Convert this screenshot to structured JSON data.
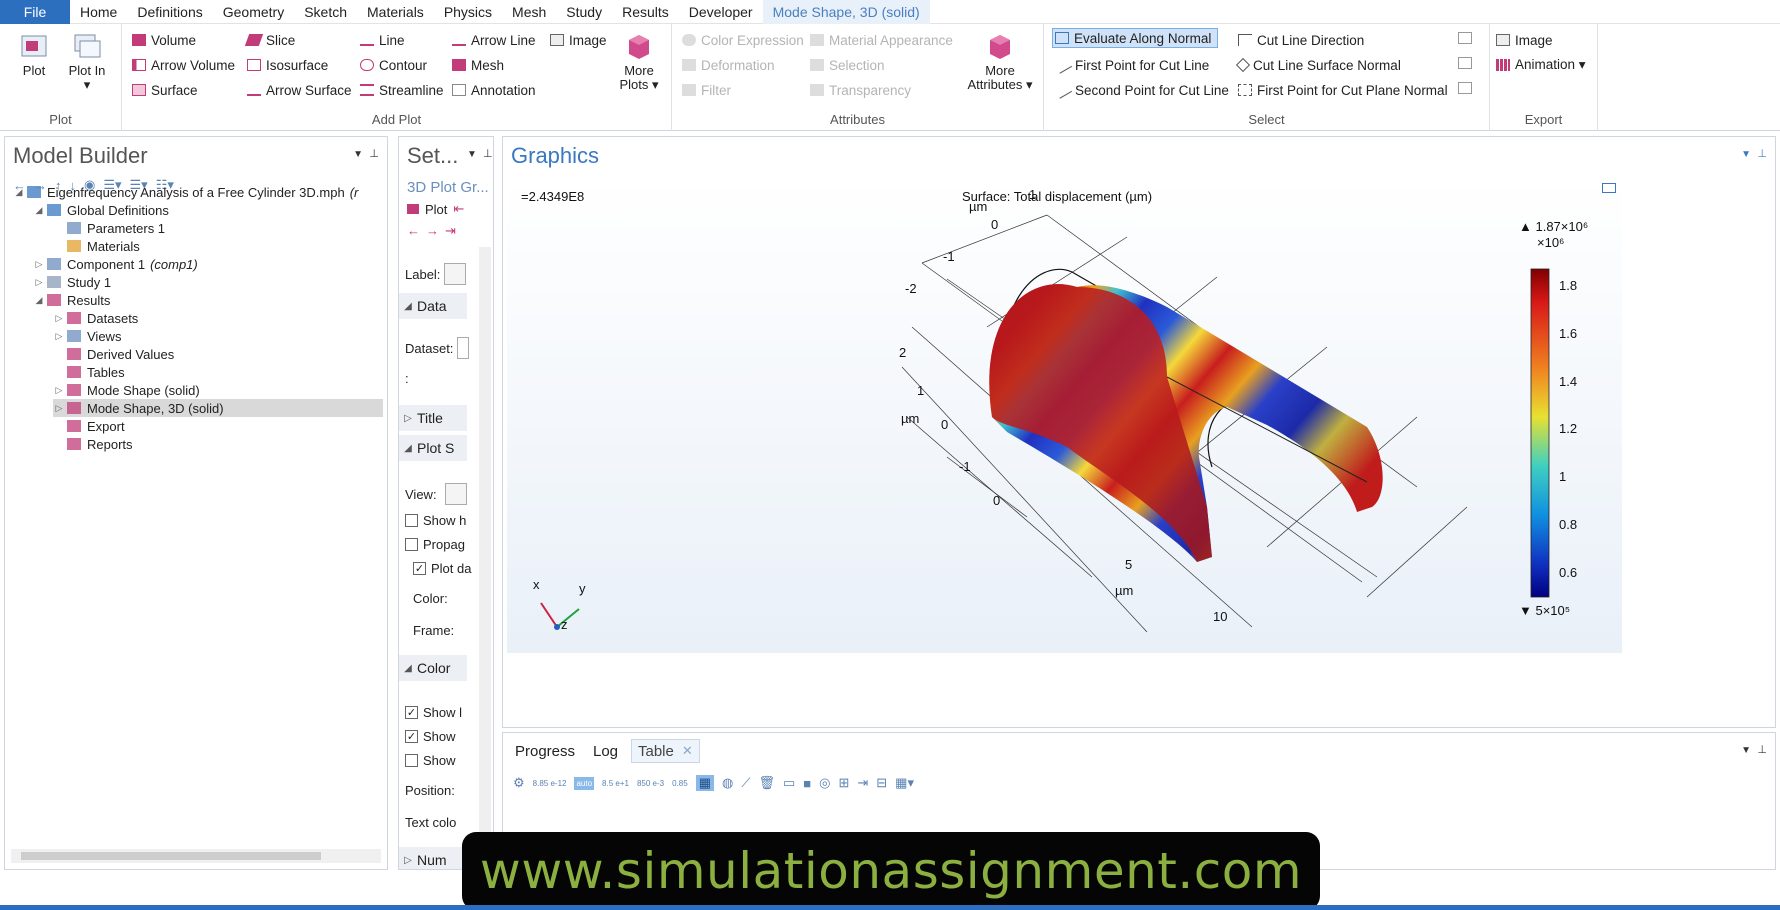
{
  "menu": {
    "file": "File",
    "items": [
      "Home",
      "Definitions",
      "Geometry",
      "Sketch",
      "Materials",
      "Physics",
      "Mesh",
      "Study",
      "Results",
      "Developer"
    ],
    "context_tab": "Mode Shape, 3D (solid)"
  },
  "ribbon": {
    "plot_group": {
      "label": "Plot",
      "plot": "Plot",
      "plot_in": "Plot In ▾"
    },
    "add_plot_group": {
      "label": "Add Plot",
      "col1": [
        "Volume",
        "Arrow Volume",
        "Surface"
      ],
      "col2": [
        "Slice",
        "Isosurface",
        "Arrow Surface"
      ],
      "col3": [
        "Line",
        "Contour",
        "Streamline"
      ],
      "col4": [
        "Arrow Line",
        "Mesh",
        "Annotation"
      ],
      "image": "Image",
      "more_plots": "More Plots ▾"
    },
    "attributes_group": {
      "label": "Attributes",
      "col1": [
        "Color Expression",
        "Deformation",
        "Filter"
      ],
      "col2": [
        "Material Appearance",
        "Selection",
        "Transparency"
      ],
      "more_attributes": "More Attributes ▾"
    },
    "select_group": {
      "label": "Select",
      "col1": [
        "Evaluate Along Normal",
        "First Point for Cut Line",
        "Second Point for Cut Line"
      ],
      "col2": [
        "Cut Line Direction",
        "Cut Line Surface Normal",
        "First Point for Cut Plane Normal"
      ]
    },
    "export_group": {
      "label": "Export",
      "image": "Image",
      "animation": "Animation ▾"
    }
  },
  "model_builder": {
    "title": "Model Builder",
    "tree": [
      {
        "label": "Eigenfrequency Analysis of a Free Cylinder 3D.mph",
        "suffix": "(r",
        "level": 0,
        "toggle": "◢"
      },
      {
        "label": "Global Definitions",
        "suffix": "",
        "level": 1,
        "toggle": "◢"
      },
      {
        "label": "Parameters 1",
        "suffix": "",
        "level": 2,
        "toggle": ""
      },
      {
        "label": "Materials",
        "suffix": "",
        "level": 2,
        "toggle": ""
      },
      {
        "label": "Component 1",
        "suffix": "(comp1)",
        "level": 1,
        "toggle": "▷"
      },
      {
        "label": "Study 1",
        "suffix": "",
        "level": 1,
        "toggle": "▷"
      },
      {
        "label": "Results",
        "suffix": "",
        "level": 1,
        "toggle": "◢"
      },
      {
        "label": "Datasets",
        "suffix": "",
        "level": 2,
        "toggle": "▷"
      },
      {
        "label": "Views",
        "suffix": "",
        "level": 2,
        "toggle": "▷"
      },
      {
        "label": "Derived Values",
        "suffix": "",
        "level": 2,
        "toggle": ""
      },
      {
        "label": "Tables",
        "suffix": "",
        "level": 2,
        "toggle": ""
      },
      {
        "label": "Mode Shape (solid)",
        "suffix": "",
        "level": 2,
        "toggle": "▷"
      },
      {
        "label": "Mode Shape, 3D (solid)",
        "suffix": "",
        "level": 2,
        "toggle": "▷"
      },
      {
        "label": "Export",
        "suffix": "",
        "level": 2,
        "toggle": ""
      },
      {
        "label": "Reports",
        "suffix": "",
        "level": 2,
        "toggle": ""
      }
    ]
  },
  "settings": {
    "title": "Set...",
    "subtitle": "3D Plot Gr...",
    "plot_btn": "Plot",
    "label_field": "Label:",
    "data_section": "Data",
    "dataset_label": "Dataset:",
    "colon": ":",
    "title_section": "Title",
    "plot_settings_section": "Plot S",
    "view_label": "View:",
    "show_h": "Show h",
    "propag": "Propag",
    "plot_da": "Plot da",
    "color_label": "Color:",
    "frame_label": "Frame:",
    "color_section": "Color",
    "show1": "Show l",
    "show2": "Show",
    "show3": "Show",
    "position_label": "Position:",
    "text_color_label": "Text colo",
    "num_section": "Num"
  },
  "graphics": {
    "title": "Graphics",
    "eigen_value": "=2.4349E8",
    "plot_title": "Surface: Total displacement (µm)",
    "axis_ticks": {
      "top": [
        "0",
        "-1",
        "-2"
      ],
      "left": [
        "2",
        "1",
        "0",
        "-1",
        "0"
      ],
      "bottom": [
        "5",
        "10"
      ],
      "top_one": "1"
    },
    "unit_top": "µm",
    "unit_left": "µm",
    "unit_bottom": "µm",
    "triad": {
      "x": "x",
      "y": "y",
      "z": "z"
    },
    "colorbar": {
      "max_label": "▲ 1.87×10⁶",
      "scale_label": "×10⁶",
      "min_label": "▼ 5×10⁵",
      "ticks": [
        "1.8",
        "1.6",
        "1.4",
        "1.2",
        "1",
        "0.8",
        "0.6"
      ],
      "tick_values": [
        1.8,
        1.6,
        1.4,
        1.2,
        1.0,
        0.8,
        0.6
      ],
      "range": [
        0.5,
        1.87
      ]
    }
  },
  "bottom_panel": {
    "tabs": [
      "Progress",
      "Log",
      "Table"
    ],
    "close": "✕",
    "tools": [
      "8.85 e-12",
      "auto",
      "8.5 e+1",
      "850 e-3",
      "0.85"
    ]
  },
  "banner": {
    "text": "www.simulationassignment.com"
  },
  "colors": {
    "accent": "#2b6fbe",
    "banner_text": "#8cb040",
    "title_blue": "#3a78c2"
  }
}
